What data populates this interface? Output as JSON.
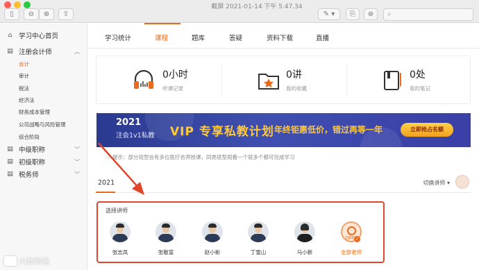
{
  "window": {
    "title": "截屏 2021-01-14 下午 5.47.34"
  },
  "sidebar": {
    "home_label": "学习中心首页",
    "sections": [
      {
        "label": "注册会计师",
        "expanded": true
      },
      {
        "label": "中级职称",
        "expanded": false
      },
      {
        "label": "初级职称",
        "expanded": false
      },
      {
        "label": "税务师",
        "expanded": false
      }
    ],
    "sub_items": [
      "会计",
      "审计",
      "税法",
      "经济法",
      "财务成本管理",
      "公司战略与风险管理",
      "综合阶段"
    ],
    "active_sub": "会计"
  },
  "tabs": [
    "学习统计",
    "课程",
    "题库",
    "答疑",
    "资料下载",
    "直播"
  ],
  "active_tab": "课程",
  "stats": [
    {
      "value": "0小时",
      "label": "听课记录",
      "icon": "headphones-icon"
    },
    {
      "value": "0讲",
      "label": "我的收藏",
      "icon": "star-folder-icon"
    },
    {
      "value": "0处",
      "label": "我的笔记",
      "icon": "notebook-icon"
    }
  ],
  "banner": {
    "year": "2021",
    "subtitle": "注会1v1私教",
    "headline": "VIP 专享私教计划",
    "slogan": "年终钜惠低价，错过再等一年",
    "cta": "立即抢占名额"
  },
  "tip": "提示：部分班型会有多位医疗名师授课，同类班型观看一个就多个都可完成学习",
  "year_tab": "2021",
  "switch_teacher": "切换讲师",
  "teacher_section": {
    "title": "选择讲师",
    "teachers": [
      "张志凤",
      "张敬富",
      "赵小彬",
      "丁雪山",
      "马小新"
    ],
    "all_label": "全部老师",
    "all_badge": "全部老师"
  },
  "watermark": "大数跨境",
  "colors": {
    "accent": "#e86a1a",
    "highlight_box": "#e0462a",
    "banner_bg": "#2f3d9a",
    "banner_text": "#ffc93c"
  }
}
